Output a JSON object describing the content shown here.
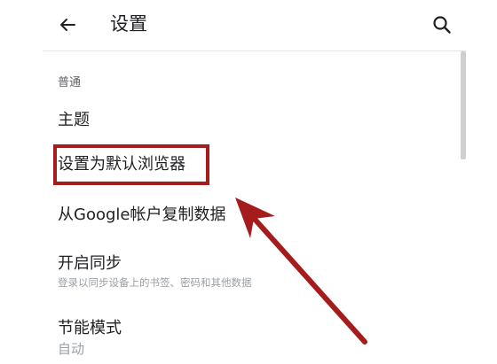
{
  "header": {
    "title": "设置"
  },
  "section": {
    "label": "普通"
  },
  "items": [
    {
      "title": "主题"
    },
    {
      "title": "设置为默认浏览器"
    },
    {
      "title": "从Google帐户复制数据"
    },
    {
      "title": "开启同步",
      "subtitle": "登录以同步设备上的书签、密码和其他数据"
    },
    {
      "title": "节能模式",
      "subtitle": "自动"
    }
  ],
  "colors": {
    "annotation": "#a51c1c",
    "divider": "#e6e6e6",
    "secondary_text": "#9aa0a6"
  },
  "icons": {
    "back": "back-arrow-icon",
    "search": "search-icon"
  }
}
